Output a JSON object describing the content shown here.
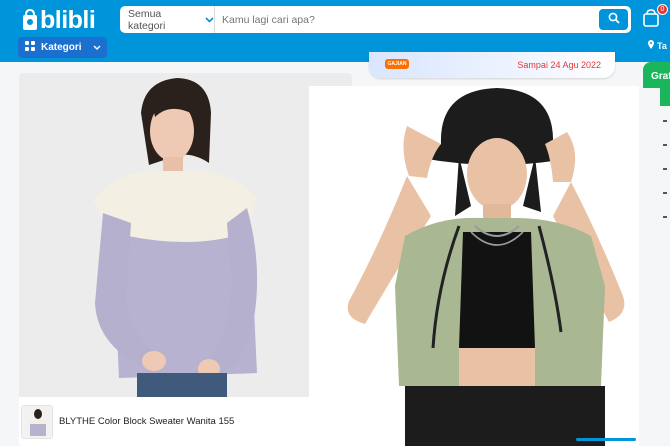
{
  "header": {
    "logo_text": "blibli",
    "search": {
      "category_label": "Semua kategori",
      "placeholder": "Kamu lagi cari apa?"
    },
    "cart_badge": "0",
    "kategori_label": "Kategori",
    "location_label": "Ta"
  },
  "promo": {
    "badge_text": "GAJIAN",
    "text": "Sampai 24 Agu 2022"
  },
  "side_banner": {
    "label": "Grat"
  },
  "product": {
    "name": "BLYTHE Color Block Sweater Wanita 155"
  },
  "colors": {
    "brand_blue": "#0095da",
    "category_blue": "#1a6fcf",
    "promo_red": "#e53935",
    "green": "#1bb55c"
  },
  "icons": [
    "bag-logo-icon",
    "chevron-down-icon",
    "search-icon",
    "cart-icon",
    "grid-icon",
    "location-pin-icon"
  ]
}
